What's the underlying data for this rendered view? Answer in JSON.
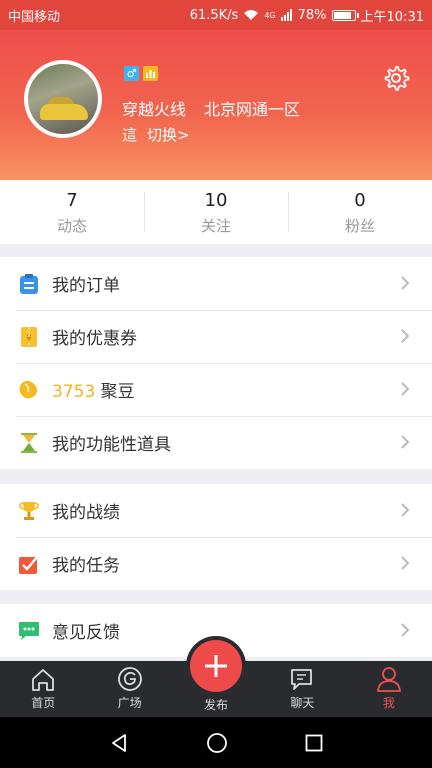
{
  "status_bar": {
    "carrier": "中国移动",
    "speed": "61.5K/s",
    "network": "4G",
    "battery": "78%",
    "battery_level": 0.78,
    "time": "上午10:31"
  },
  "profile": {
    "gender_badge": "♂",
    "nickname": "穿越火线",
    "server": "北京网通一区",
    "role": "這",
    "switch_label": "切换>"
  },
  "stats": [
    {
      "value": "7",
      "label": "动态"
    },
    {
      "value": "10",
      "label": "关注"
    },
    {
      "value": "0",
      "label": "粉丝"
    }
  ],
  "menu": {
    "orders": "我的订单",
    "coupons": "我的优惠券",
    "beans_count": "3753",
    "beans_label": "聚豆",
    "items": "我的功能性道具",
    "records": "我的战绩",
    "tasks": "我的任务",
    "feedback": "意见反馈"
  },
  "tabbar": {
    "home": "首页",
    "square": "广场",
    "publish": "发布",
    "chat": "聊天",
    "me": "我"
  },
  "colors": {
    "accent": "#ee4a4a",
    "beans": "#f4b41a"
  }
}
